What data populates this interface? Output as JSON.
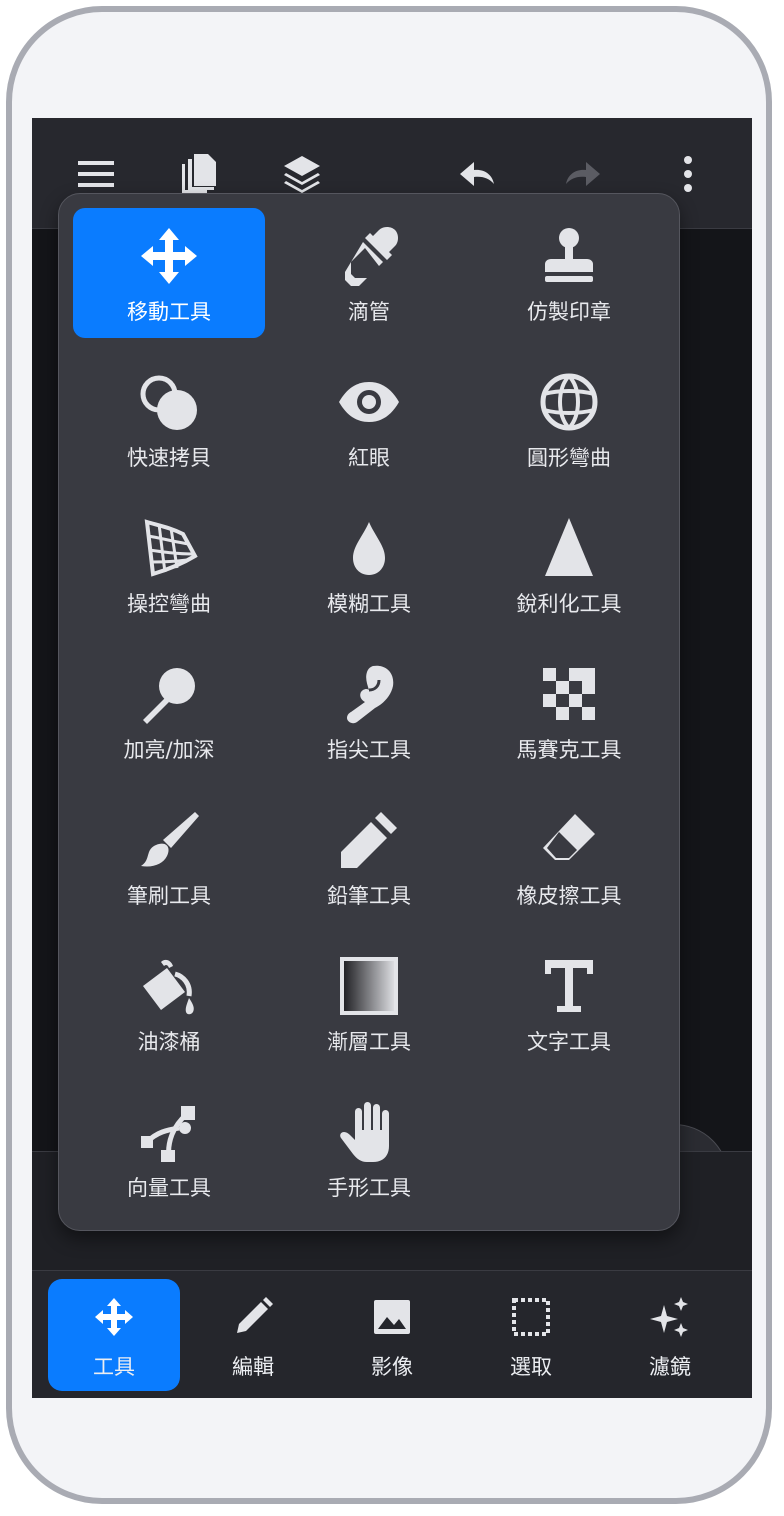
{
  "colors": {
    "accent": "#0a7cff",
    "menu_bg": "#393a41",
    "bar_bg": "#27282e",
    "icon": "#e3e4e8"
  },
  "topbar": {
    "icons": [
      "menu-icon",
      "pages-icon",
      "layers-icon",
      "undo-icon",
      "redo-icon",
      "more-vert-icon"
    ]
  },
  "tool_menu": {
    "items": [
      {
        "label": "移動工具",
        "icon": "move-icon",
        "active": true
      },
      {
        "label": "滴管",
        "icon": "eyedropper-icon"
      },
      {
        "label": "仿製印章",
        "icon": "stamp-icon"
      },
      {
        "label": "快速拷貝",
        "icon": "quick-copy-icon"
      },
      {
        "label": "紅眼",
        "icon": "eye-icon"
      },
      {
        "label": "圓形彎曲",
        "icon": "globe-icon"
      },
      {
        "label": "操控彎曲",
        "icon": "mesh-warp-icon"
      },
      {
        "label": "模糊工具",
        "icon": "drop-icon"
      },
      {
        "label": "銳利化工具",
        "icon": "triangle-icon"
      },
      {
        "label": "加亮/加深",
        "icon": "dodge-burn-icon"
      },
      {
        "label": "指尖工具",
        "icon": "finger-icon"
      },
      {
        "label": "馬賽克工具",
        "icon": "checkerboard-icon"
      },
      {
        "label": "筆刷工具",
        "icon": "brush-icon"
      },
      {
        "label": "鉛筆工具",
        "icon": "pencil-icon"
      },
      {
        "label": "橡皮擦工具",
        "icon": "eraser-icon"
      },
      {
        "label": "油漆桶",
        "icon": "paint-bucket-icon"
      },
      {
        "label": "漸層工具",
        "icon": "gradient-icon"
      },
      {
        "label": "文字工具",
        "icon": "text-icon"
      },
      {
        "label": "向量工具",
        "icon": "vector-icon"
      },
      {
        "label": "手形工具",
        "icon": "hand-icon"
      }
    ]
  },
  "bottom_nav": {
    "items": [
      {
        "label": "工具",
        "icon": "move-icon",
        "active": true
      },
      {
        "label": "編輯",
        "icon": "pen-icon"
      },
      {
        "label": "影像",
        "icon": "image-icon"
      },
      {
        "label": "選取",
        "icon": "selection-icon"
      },
      {
        "label": "濾鏡",
        "icon": "sparkle-icon"
      }
    ]
  }
}
